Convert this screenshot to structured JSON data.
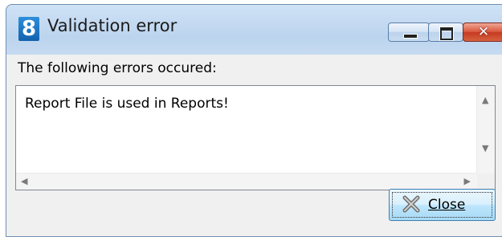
{
  "window": {
    "app_icon_glyph": "8",
    "title": "Validation error",
    "minimize_glyph": "",
    "maximize_glyph": "",
    "close_glyph": "✕"
  },
  "dialog": {
    "header": "The following errors occured:",
    "message": "Report File is used in Reports!",
    "close_button_label": "Close"
  },
  "icons": {
    "app": "app-logo-icon",
    "minimize": "minimize-icon",
    "maximize": "maximize-icon",
    "close": "close-icon",
    "close_button": "close-x-icon"
  },
  "colors": {
    "titlebar": "#c5daf1",
    "close_button_accent": "#c63a22",
    "app_icon": "#1e78c8"
  }
}
